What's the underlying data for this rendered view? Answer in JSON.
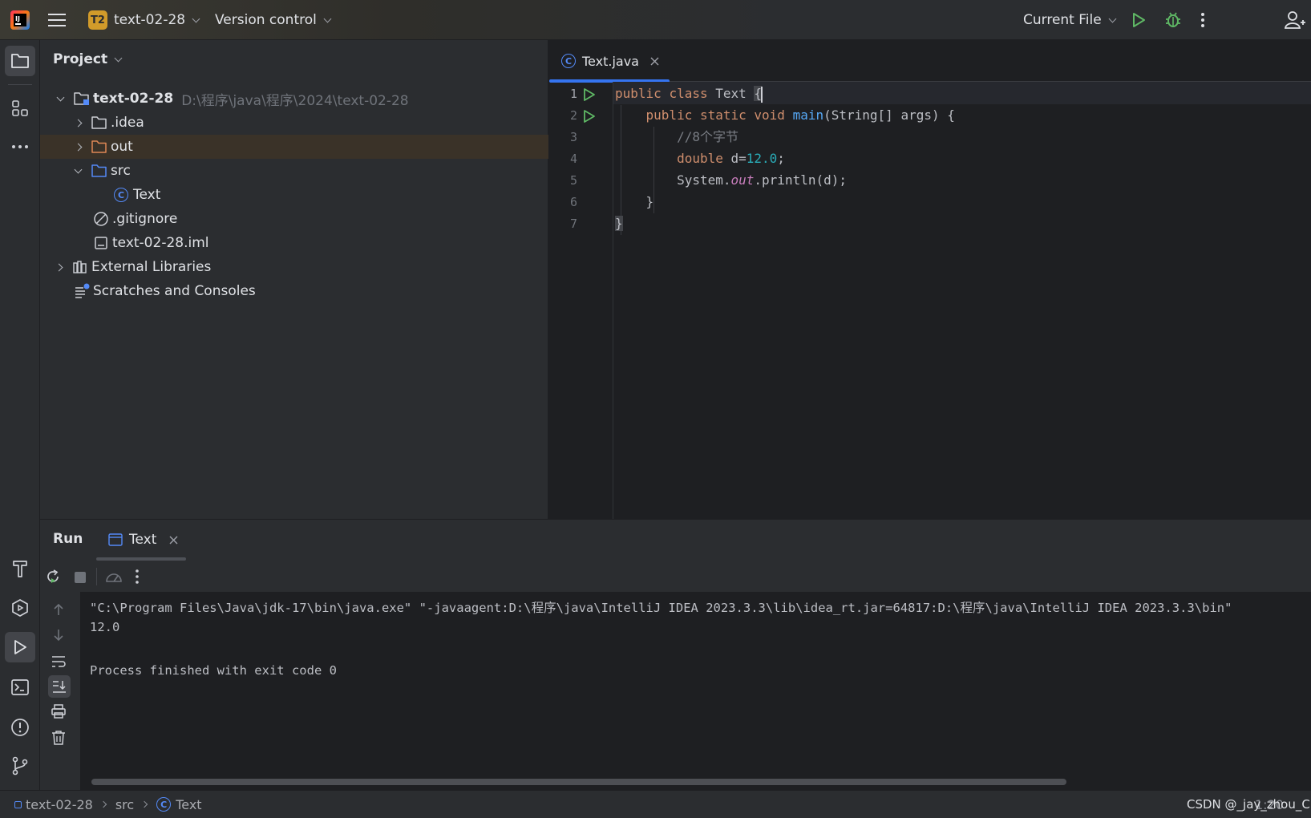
{
  "titlebar": {
    "project_badge": "T2",
    "project_name": "text-02-28",
    "vcs_label": "Version control",
    "run_config": "Current File"
  },
  "project_panel": {
    "title": "Project",
    "tree": [
      {
        "label": "text-02-28",
        "path": "D:\\程序\\java\\程序\\2024\\text-02-28"
      },
      {
        "label": ".idea"
      },
      {
        "label": "out"
      },
      {
        "label": "src"
      },
      {
        "label": "Text"
      },
      {
        "label": ".gitignore"
      },
      {
        "label": "text-02-28.iml"
      },
      {
        "label": "External Libraries"
      },
      {
        "label": "Scratches and Consoles"
      }
    ]
  },
  "editor": {
    "tab_label": "Text.java",
    "line_numbers": [
      "1",
      "2",
      "3",
      "4",
      "5",
      "6",
      "7"
    ],
    "code": {
      "l1_kw1": "public",
      "l1_kw2": "class",
      "l1_name": "Text",
      "l1_brace": "{",
      "l2_kw1": "public",
      "l2_kw2": "static",
      "l2_kw3": "void",
      "l2_fn": "main",
      "l2_rest": "(String[] args) {",
      "l3_comment": "//8个字节",
      "l4_kw": "double",
      "l4_var": " d=",
      "l4_num": "12.0",
      "l4_end": ";",
      "l5_a": "System.",
      "l5_field": "out",
      "l5_b": ".println(d);",
      "l6": "}",
      "l7": "}"
    }
  },
  "run_panel": {
    "title": "Run",
    "tab_label": "Text",
    "console": [
      "\"C:\\Program Files\\Java\\jdk-17\\bin\\java.exe\" \"-javaagent:D:\\程序\\java\\IntelliJ IDEA 2023.3.3\\lib\\idea_rt.jar=64817:D:\\程序\\java\\IntelliJ IDEA 2023.3.3\\bin\"",
      "12.0",
      "",
      "Process finished with exit code 0"
    ]
  },
  "statusbar": {
    "breadcrumbs": [
      "text-02-28",
      "src",
      "Text"
    ],
    "position": "1:20",
    "watermark": "CSDN @_jay_zhou_CF"
  },
  "colors": {
    "accent": "#3574f0",
    "run_green": "#5fb865",
    "folder_blue": "#548af7",
    "folder_orange": "#e08855"
  }
}
